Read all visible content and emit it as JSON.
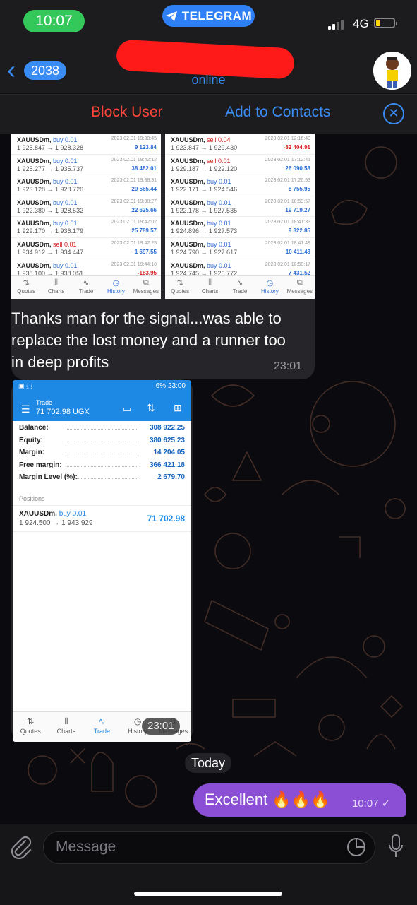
{
  "status_bar": {
    "time": "10:07",
    "app_pill": "TELEGRAM",
    "network": "4G"
  },
  "header": {
    "back_count": "2038",
    "status": "online"
  },
  "action_bar": {
    "block": "Block User",
    "add": "Add to Contacts"
  },
  "screenshot_left": {
    "rows": [
      {
        "sym": "XAUUSDm,",
        "side": "buy 0.01",
        "prices": "1 925.847 → 1 928.328",
        "date": "2023.02.01 19:38:45",
        "pl": "9 123.84"
      },
      {
        "sym": "XAUUSDm,",
        "side": "buy 0.01",
        "prices": "1 925.277 → 1 935.737",
        "date": "2023.02.01 19:42:12",
        "pl": "38 482.01"
      },
      {
        "sym": "XAUUSDm,",
        "side": "buy 0.01",
        "prices": "1 923.128 → 1 928.720",
        "date": "2023.02.01 19:38:31",
        "pl": "20 565.44"
      },
      {
        "sym": "XAUUSDm,",
        "side": "buy 0.01",
        "prices": "1 922.380 → 1 928.532",
        "date": "2023.02.01 19:38:27",
        "pl": "22 625.66"
      },
      {
        "sym": "XAUUSDm,",
        "side": "buy 0.01",
        "prices": "1 929.170 → 1 936.179",
        "date": "2023.02.01 19:42:02",
        "pl": "25 789.57"
      },
      {
        "sym": "XAUUSDm,",
        "side": "sell 0.01",
        "prices": "1 934.912 → 1 934.447",
        "date": "2023.02.01 19:42:25",
        "pl": "1 697.55"
      },
      {
        "sym": "XAUUSDm,",
        "side": "buy 0.01",
        "prices": "1 938.100 → 1 938.051",
        "date": "2023.02.01 19:44:10",
        "pl": "-183.95"
      }
    ]
  },
  "screenshot_right": {
    "rows": [
      {
        "sym": "XAUUSDm,",
        "side": "sell 0.04",
        "prices": "1 923.847 → 1 929.430",
        "date": "2023.02.01 12:16:49",
        "pl": "-82 404.91"
      },
      {
        "sym": "XAUUSDm,",
        "side": "sell 0.01",
        "prices": "1 929.187 → 1 922.120",
        "date": "2023.02.01 17:12:41",
        "pl": "26 090.58"
      },
      {
        "sym": "XAUUSDm,",
        "side": "buy 0.01",
        "prices": "1 922.171 → 1 924.546",
        "date": "2023.02.01 17:26:53",
        "pl": "8 755.95"
      },
      {
        "sym": "XAUUSDm,",
        "side": "buy 0.01",
        "prices": "1 922.178 → 1 927.535",
        "date": "2023.02.01 18:59:57",
        "pl": "19 719.27"
      },
      {
        "sym": "XAUUSDm,",
        "side": "buy 0.01",
        "prices": "1 924.896 → 1 927.573",
        "date": "2023.02.01 18:41:33",
        "pl": "9 822.85"
      },
      {
        "sym": "XAUUSDm,",
        "side": "buy 0.01",
        "prices": "1 924.790 → 1 927.617",
        "date": "2023.02.01 18:41:49",
        "pl": "10 411.48"
      },
      {
        "sym": "XAUUSDm,",
        "side": "buy 0.01",
        "prices": "1 924.745 → 1 926.772",
        "date": "2023.02.01 18:58:17",
        "pl": "7 431.52"
      }
    ]
  },
  "mt_tabs": [
    "Quotes",
    "Charts",
    "Trade",
    "History",
    "Messages"
  ],
  "message1": {
    "text": "Thanks man for the signal...was able to replace the lost money and a runner  too in deep profits",
    "time": "23:01"
  },
  "phone": {
    "status": "6%  23:00",
    "title": "Trade",
    "amount": "71 702.98 UGX",
    "account": [
      {
        "k": "Balance:",
        "v": "308 922.25"
      },
      {
        "k": "Equity:",
        "v": "380 625.23"
      },
      {
        "k": "Margin:",
        "v": "14 204.05"
      },
      {
        "k": "Free margin:",
        "v": "366 421.18"
      },
      {
        "k": "Margin Level (%):",
        "v": "2 679.70"
      }
    ],
    "positions_label": "Positions",
    "position": {
      "sym": "XAUUSDm,",
      "side": "buy 0.01",
      "prices": "1 924.500 → 1 943.929",
      "pl": "71 702.98"
    },
    "tabs": [
      "Quotes",
      "Charts",
      "Trade",
      "History",
      "Messages"
    ]
  },
  "message2": {
    "time": "23:01"
  },
  "date_divider": "Today",
  "message3": {
    "text": "Excellent 🔥🔥🔥",
    "time": "10:07"
  },
  "input": {
    "placeholder": "Message"
  },
  "colors": {
    "accent": "#3a8cf5",
    "danger": "#ff453a",
    "outgoing": "#8a4fd4",
    "bar": "#1c1c1e"
  }
}
